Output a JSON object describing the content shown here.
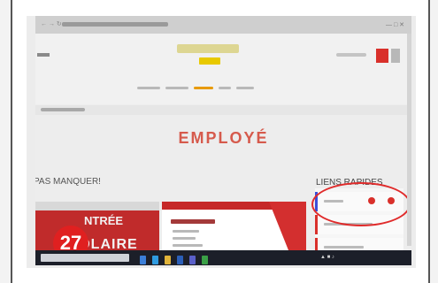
{
  "page": {
    "heading": "EMPLOYÉ",
    "section_left": "PAS MANQUER!",
    "section_right": "LIENS RAPIDES"
  },
  "card_banner": {
    "line1": "NTRÉE",
    "line2": "SCOLAIRE"
  },
  "badge": {
    "number": "27"
  },
  "colors": {
    "accent_red": "#d9302b",
    "heading_red": "#d65a4c",
    "logo_yellow": "#e8c900",
    "taskbar": "#1c1f29"
  },
  "icons": [
    "back-arrow-icon",
    "refresh-icon",
    "minimize-icon",
    "close-icon",
    "windows-start-icon",
    "edge-icon",
    "file-explorer-icon",
    "word-icon",
    "teams-icon"
  ]
}
